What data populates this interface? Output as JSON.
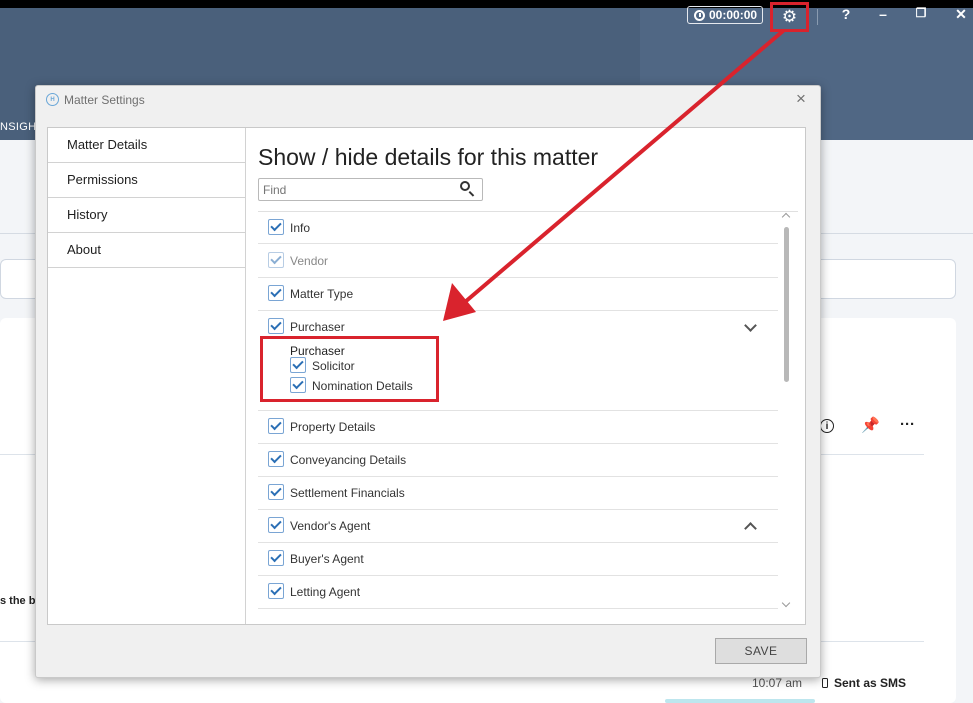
{
  "header": {
    "insight_text": "NSIGHT",
    "timer": "00:00:00",
    "help_label": "?",
    "minimize_label": "–",
    "restore_label": "❐",
    "close_label": "✕"
  },
  "background": {
    "truncated_text": "s the b",
    "time": "10:07 am",
    "sms_label": "Sent as SMS"
  },
  "dialog": {
    "title": "Matter Settings",
    "close_label": "×",
    "nav": [
      {
        "label": "Matter Details"
      },
      {
        "label": "Permissions"
      },
      {
        "label": "History"
      },
      {
        "label": "About"
      }
    ],
    "heading": "Show / hide details for this matter",
    "find_placeholder": "Find",
    "items": [
      {
        "label": "Info",
        "checked": true
      },
      {
        "label": "Vendor",
        "checked": true,
        "disabled": true
      },
      {
        "label": "Matter Type",
        "checked": true
      },
      {
        "label": "Purchaser",
        "checked": true,
        "expanded": true
      },
      {
        "label": "Property Details",
        "checked": true
      },
      {
        "label": "Conveyancing Details",
        "checked": true
      },
      {
        "label": "Settlement Financials",
        "checked": true
      },
      {
        "label": "Vendor's Agent",
        "checked": true,
        "collapsible": true
      },
      {
        "label": "Buyer's Agent",
        "checked": true
      },
      {
        "label": "Letting Agent",
        "checked": true
      }
    ],
    "purchaser_group": {
      "heading": "Purchaser",
      "subitems": [
        {
          "label": "Solicitor",
          "checked": true
        },
        {
          "label": "Nomination Details",
          "checked": true
        }
      ]
    },
    "save_label": "SAVE"
  },
  "colors": {
    "header": "#4a607b",
    "annotation_red": "#d9232d",
    "checkbox_blue": "#2b6fb5"
  }
}
